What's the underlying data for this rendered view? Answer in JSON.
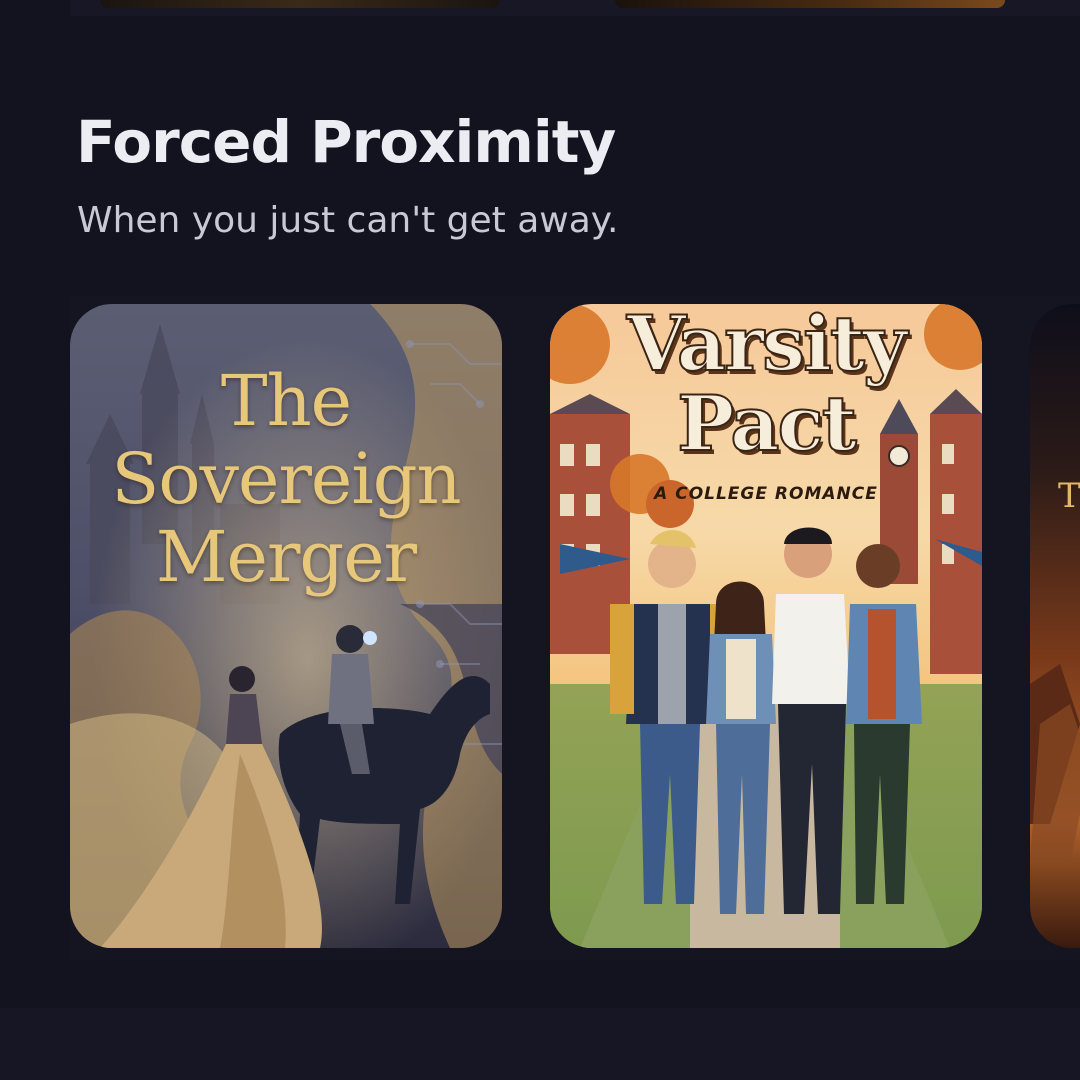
{
  "section": {
    "title": "Forced Proximity",
    "subtitle": "When you just can't get away."
  },
  "books": [
    {
      "title_lines": [
        "The",
        "Sovereign",
        "Merger"
      ]
    },
    {
      "title_lines": [
        "Varsity",
        "Pact"
      ],
      "tagline": "A COLLEGE ROMANCE"
    },
    {
      "title_fragment": "Th"
    }
  ],
  "colors": {
    "background": "#13131f",
    "title_text": "#ececf3",
    "subtitle_text": "#c9c9d6",
    "sovereign_gold": "#e7c77a"
  }
}
